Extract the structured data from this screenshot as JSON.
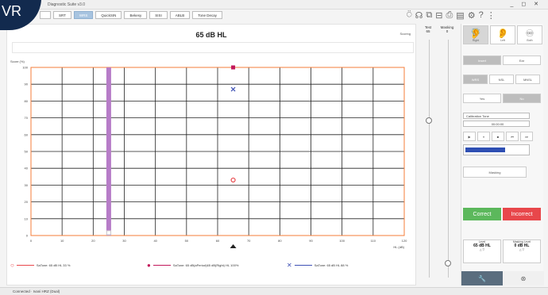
{
  "window": {
    "title": "Diagnostic Suite  v3.0",
    "controls": "_ ◻ ✕"
  },
  "brand": {
    "text": "VR"
  },
  "toolbar": {
    "tabs": [
      "",
      "SRT",
      "WRS",
      "QuickSIN",
      "Bekesy",
      "SISI",
      "ABLB",
      "Tone Decay"
    ],
    "active_index": 2
  },
  "level": {
    "title": "65 dB HL",
    "scoring": "Scoring"
  },
  "chart_data": {
    "type": "scatter",
    "title": "65 dB HL",
    "ylabel": "Score (%)",
    "xlabel": "HL (dB)",
    "xlim": [
      0,
      120
    ],
    "ylim": [
      0,
      100
    ],
    "x_ticks": [
      0,
      10,
      20,
      30,
      40,
      50,
      60,
      70,
      80,
      90,
      100,
      110,
      120
    ],
    "y_ticks": [
      0,
      10,
      20,
      30,
      40,
      50,
      60,
      70,
      80,
      90,
      100
    ],
    "grid": true,
    "series": [
      {
        "symbol": "circle",
        "color": "#e8474b",
        "points": [
          [
            65,
            33
          ]
        ]
      },
      {
        "symbol": "square",
        "color": "#c2185b",
        "points": [
          [
            65,
            100
          ]
        ]
      },
      {
        "symbol": "cross",
        "color": "#3f51b5",
        "points": [
          [
            65,
            87
          ]
        ]
      }
    ],
    "bar": {
      "x": 25,
      "from": 0,
      "to": 100,
      "color": "#b77cc8"
    },
    "marker_x": 65
  },
  "legend": {
    "items": [
      {
        "symbol": "○",
        "color": "#e8474b",
        "text": "SaTone: 65 dB HL 33 %"
      },
      {
        "symbol": "●",
        "color": "#c2185b",
        "text": "SaTone: 65 dB(aPeriod)65 dB(Right) HL 100%"
      },
      {
        "symbol": "✕",
        "color": "#3f51b5",
        "text": "SaTone: 65 dB HL 88 %"
      }
    ]
  },
  "sliders": {
    "test_label": "Test",
    "test_value": "65",
    "masking_label": "Masking",
    "masking_value": "0"
  },
  "panel": {
    "ears": [
      {
        "label": "Right",
        "icon": "🦻"
      },
      {
        "label": "Left",
        "icon": "👂"
      },
      {
        "label": "Both",
        "icon": "♾"
      }
    ],
    "transducers": [
      "Insert",
      "Ear"
    ],
    "modes": [
      "WRS",
      "NSL",
      "MNSL"
    ],
    "toggle": [
      "Yes",
      "No"
    ],
    "calibration_select": "Calibration Tone",
    "file_value": "00:00:00",
    "player_controls": [
      "▶",
      "⏸",
      "■",
      "⏮",
      "⏭"
    ],
    "masking_btn": "Masking",
    "correct": "Correct",
    "incorrect": "Incorrect",
    "level_label": "Level",
    "level_value": "65 dB HL",
    "masking_level_label": "Masking Level",
    "masking_level_value": "0 dB HL"
  },
  "status": {
    "text": "Connected · Ivani HRZ (Dual)"
  }
}
